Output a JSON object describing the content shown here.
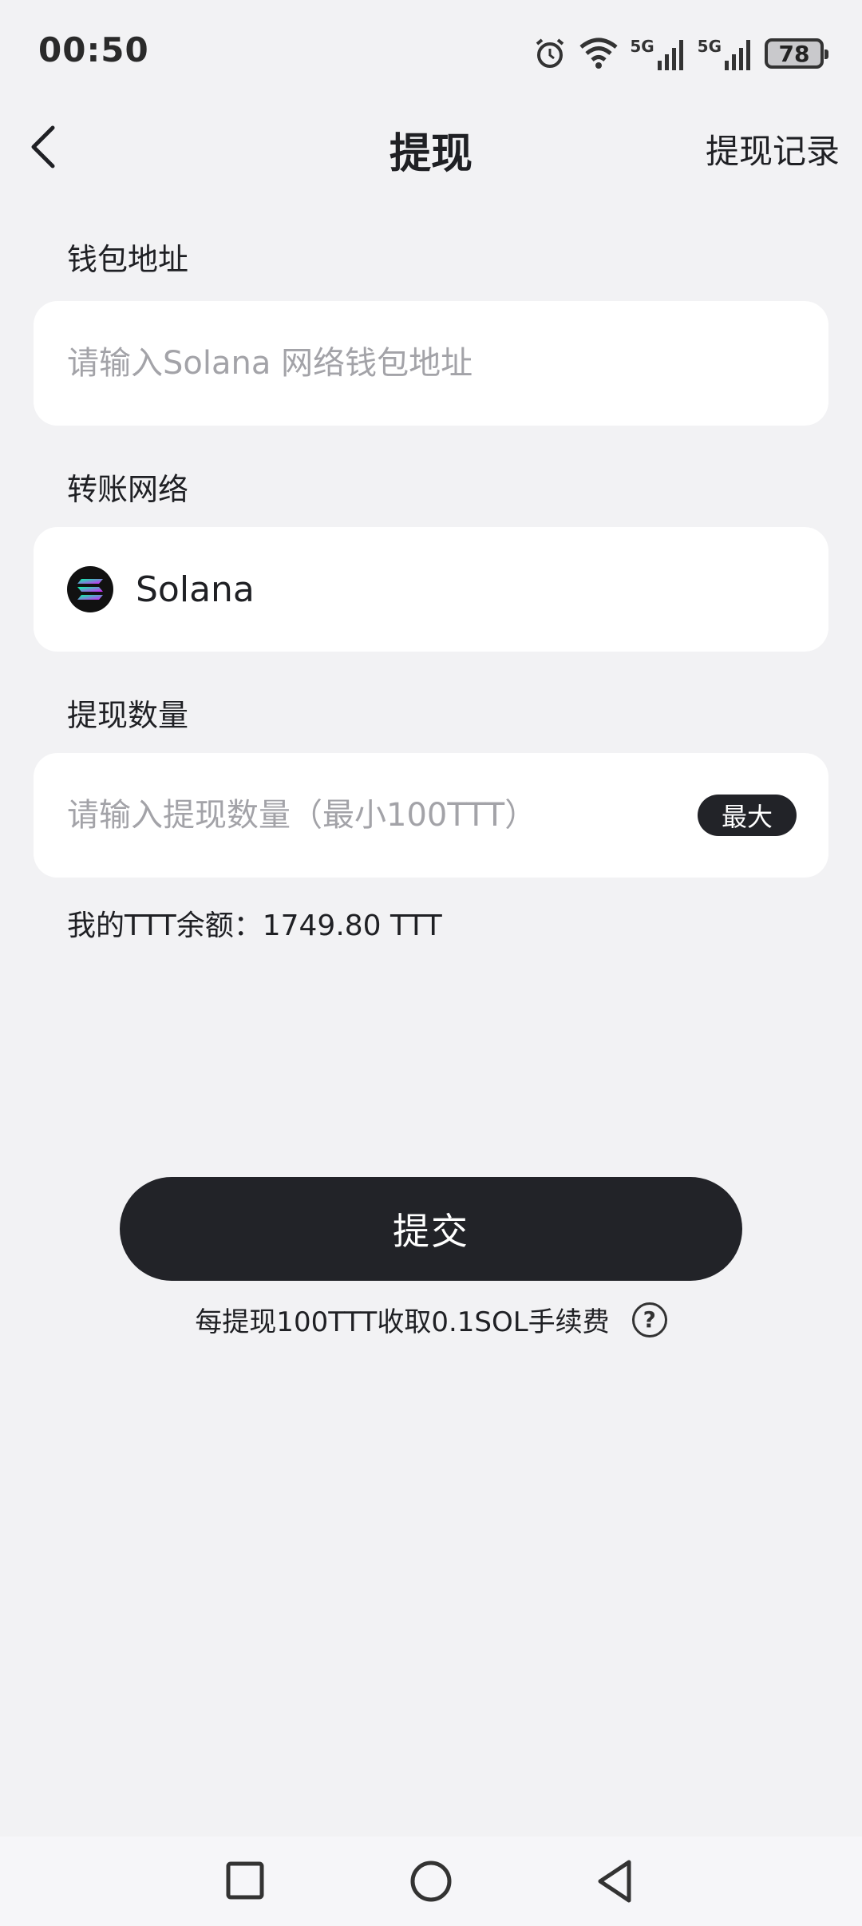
{
  "status_bar": {
    "time": "00:50",
    "network_1": "5G",
    "network_2": "5G",
    "battery": "78"
  },
  "header": {
    "title": "提现",
    "history_label": "提现记录"
  },
  "wallet": {
    "label": "钱包地址",
    "placeholder": "请输入Solana 网络钱包地址"
  },
  "network": {
    "label": "转账网络",
    "value": "Solana",
    "icon": "solana-logo-icon"
  },
  "amount": {
    "label": "提现数量",
    "placeholder": "请输入提现数量（最小100TTT）",
    "max_label": "最大"
  },
  "balance": {
    "text": "我的TTT余额：1749.80 TTT"
  },
  "submit": {
    "label": "提交"
  },
  "fee": {
    "text": "每提现100TTT收取0.1SOL手续费",
    "help_symbol": "?"
  },
  "colors": {
    "background": "#f2f2f4",
    "card": "#ffffff",
    "primary_dark": "#222328",
    "placeholder": "#a3a3a8"
  }
}
